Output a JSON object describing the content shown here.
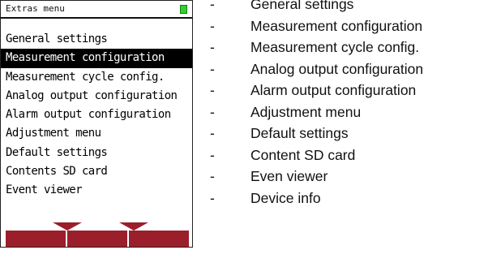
{
  "device": {
    "title": "Extras menu",
    "battery_color": "#2fd12f",
    "menu_items": [
      "General settings",
      "Measurement configuration",
      "Measurement cycle config.",
      "Analog output configuration",
      "Alarm output configuration",
      "Adjustment menu",
      "Default settings",
      "Contents SD card",
      "Event viewer"
    ],
    "selected_item": "Measurement configuration",
    "softkey_color": "#9b1e2b"
  },
  "captions": {
    "bullet": "-",
    "items": [
      "General settings",
      "Measurement configuration",
      "Measurement cycle config.",
      "Analog output configuration",
      "Alarm output configuration",
      "Adjustment menu",
      "Default settings",
      "Content SD card",
      "Even viewer",
      "Device info"
    ]
  }
}
